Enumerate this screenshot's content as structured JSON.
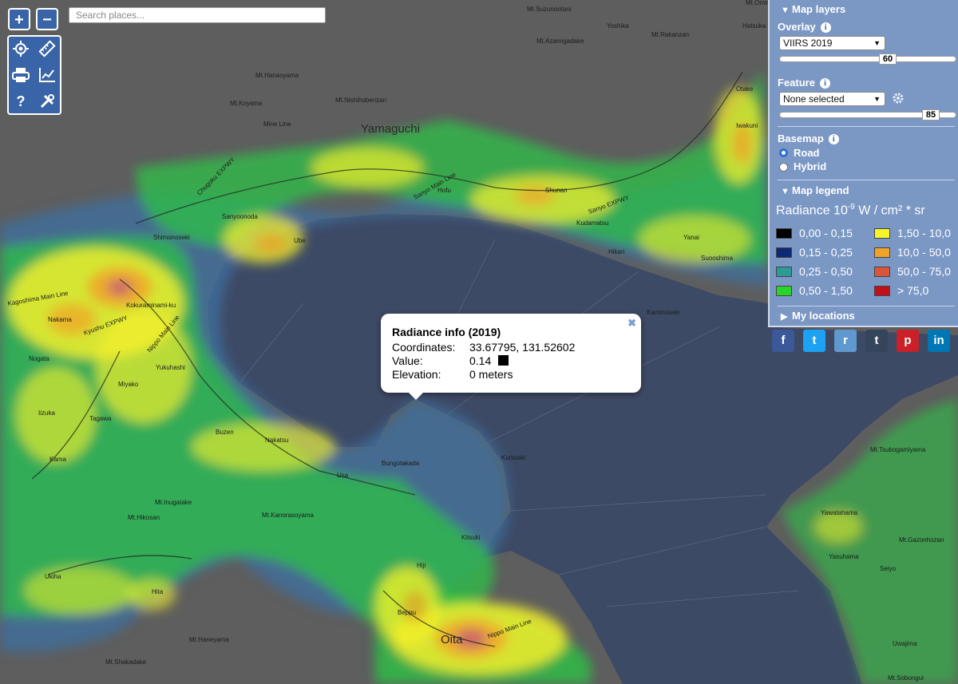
{
  "search": {
    "placeholder": "Search places..."
  },
  "zoom": {
    "in": "+",
    "out": "−"
  },
  "tools": {
    "help_label": "?"
  },
  "map": {
    "labels": [
      {
        "text": "Yamaguchi",
        "cls": "big"
      },
      {
        "text": "Shimonoseki",
        "cls": ""
      },
      {
        "text": "Hofu",
        "cls": ""
      },
      {
        "text": "Shunan",
        "cls": ""
      },
      {
        "text": "Ube",
        "cls": ""
      },
      {
        "text": "Sanyoonoda",
        "cls": ""
      },
      {
        "text": "Kudamatsu",
        "cls": ""
      },
      {
        "text": "Hikari",
        "cls": ""
      },
      {
        "text": "Yanai",
        "cls": ""
      },
      {
        "text": "Iwakuni",
        "cls": ""
      },
      {
        "text": "Otake",
        "cls": ""
      },
      {
        "text": "Suooshima",
        "cls": ""
      },
      {
        "text": "Kaminoseki",
        "cls": ""
      },
      {
        "text": "Mt.Suzunootani",
        "cls": ""
      },
      {
        "text": "Mt.Azamigadake",
        "cls": ""
      },
      {
        "text": "Mt.Rakanzan",
        "cls": ""
      },
      {
        "text": "Yoshika",
        "cls": ""
      },
      {
        "text": "Hatsuka",
        "cls": ""
      },
      {
        "text": "Mt.Hanaoyama",
        "cls": ""
      },
      {
        "text": "Mt.Koyama",
        "cls": ""
      },
      {
        "text": "Mt.Nishihobenzan",
        "cls": ""
      },
      {
        "text": "Mine Line",
        "cls": ""
      },
      {
        "text": "Kokuraminami-ku",
        "cls": ""
      },
      {
        "text": "Nakama",
        "cls": ""
      },
      {
        "text": "Nogata",
        "cls": ""
      },
      {
        "text": "Iizuka",
        "cls": ""
      },
      {
        "text": "Miyako",
        "cls": ""
      },
      {
        "text": "Tagawa",
        "cls": ""
      },
      {
        "text": "Kama",
        "cls": ""
      },
      {
        "text": "Yukuhashi",
        "cls": ""
      },
      {
        "text": "Buzen",
        "cls": ""
      },
      {
        "text": "Nakatsu",
        "cls": ""
      },
      {
        "text": "Usa",
        "cls": ""
      },
      {
        "text": "Bungotakada",
        "cls": ""
      },
      {
        "text": "Kunisaki",
        "cls": ""
      },
      {
        "text": "Kitsuki",
        "cls": ""
      },
      {
        "text": "Hiji",
        "cls": ""
      },
      {
        "text": "Beppu",
        "cls": ""
      },
      {
        "text": "Oita",
        "cls": "big"
      },
      {
        "text": "Hita",
        "cls": ""
      },
      {
        "text": "Ukiha",
        "cls": ""
      },
      {
        "text": "Mt.Inugatake",
        "cls": ""
      },
      {
        "text": "Mt.Hikosan",
        "cls": ""
      },
      {
        "text": "Mt.Kanorasoyama",
        "cls": ""
      },
      {
        "text": "Mt.Haneyama",
        "cls": ""
      },
      {
        "text": "Mt.Shakadake",
        "cls": ""
      },
      {
        "text": "Mt.Sobongui",
        "cls": ""
      },
      {
        "text": "Yawatahama",
        "cls": ""
      },
      {
        "text": "Yasuhama",
        "cls": ""
      },
      {
        "text": "Mt.Tsubogamiyama",
        "cls": ""
      },
      {
        "text": "Mt.Gazonhozan",
        "cls": ""
      },
      {
        "text": "Seiyo",
        "cls": ""
      },
      {
        "text": "Uwajima",
        "cls": ""
      },
      {
        "text": "Mt.Omine",
        "cls": ""
      },
      {
        "text": "Sanyo Main Line",
        "cls": ""
      },
      {
        "text": "Chugoku EXPWY",
        "cls": ""
      },
      {
        "text": "Sanyo EXPWY",
        "cls": ""
      },
      {
        "text": "Kyushu EXPWY",
        "cls": ""
      },
      {
        "text": "Nippo Main Line",
        "cls": ""
      },
      {
        "text": "Kagoshima Main Line",
        "cls": ""
      },
      {
        "text": "Nippo Main Line",
        "cls": ""
      }
    ]
  },
  "popup": {
    "title": "Radiance info (2019)",
    "coords_label": "Coordinates:",
    "coords_value": "33.67795, 131.52602",
    "value_label": "Value:",
    "value_value": "0.14",
    "value_color": "#000000",
    "elev_label": "Elevation:",
    "elev_value": "0 meters",
    "close": "✖"
  },
  "panel": {
    "layers_title": "Map layers",
    "overlay_label": "Overlay",
    "overlay_value": "VIIRS 2019",
    "overlay_slider": "60",
    "feature_label": "Feature",
    "feature_value": "None selected",
    "feature_slider": "85",
    "basemap_label": "Basemap",
    "basemap_options": [
      "Road",
      "Hybrid"
    ],
    "basemap_selected": "Road",
    "legend_title": "Map legend",
    "legend_unit_prefix": "Radiance 10",
    "legend_unit_exp": "-9",
    "legend_unit_suffix": " W / cm² * sr",
    "legend_items": [
      {
        "range": "0,00 - 0,15",
        "color": "#000000"
      },
      {
        "range": "0,15 - 0,25",
        "color": "#0b2a73"
      },
      {
        "range": "0,25 - 0,50",
        "color": "#2e9a95"
      },
      {
        "range": "0,50 - 1,50",
        "color": "#2ad42a"
      },
      {
        "range": "1,50 - 10,0",
        "color": "#f7f52a"
      },
      {
        "range": "10,0 - 50,0",
        "color": "#f0a22a"
      },
      {
        "range": "50,0 - 75,0",
        "color": "#d9563a"
      },
      {
        "range": "> 75,0",
        "color": "#c0101a"
      }
    ],
    "locations_title": "My locations"
  },
  "share": [
    {
      "name": "facebook-icon",
      "glyph": "f",
      "color": "#3b5998"
    },
    {
      "name": "twitter-icon",
      "glyph": "t",
      "color": "#1da1f2"
    },
    {
      "name": "reddit-icon",
      "glyph": "r",
      "color": "#5f99cf"
    },
    {
      "name": "tumblr-icon",
      "glyph": "t",
      "color": "#35465c"
    },
    {
      "name": "pinterest-icon",
      "glyph": "p",
      "color": "#cb2027"
    },
    {
      "name": "linkedin-icon",
      "glyph": "in",
      "color": "#0077b5"
    }
  ]
}
